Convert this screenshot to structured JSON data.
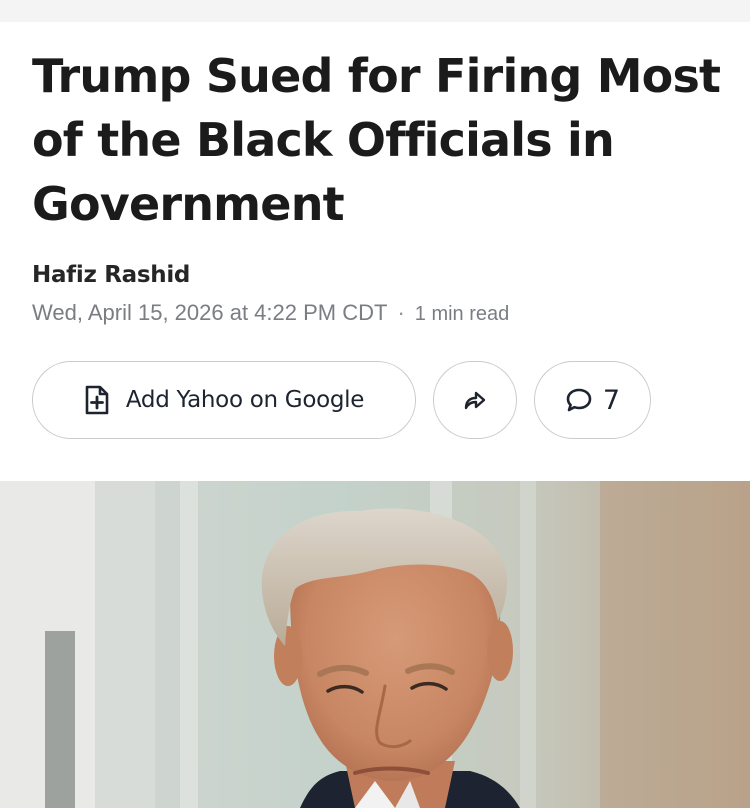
{
  "article": {
    "headline": "Trump Sued for Firing Most of the Black Officials in Government",
    "author": "Hafiz Rashid",
    "published": "Wed, April 15, 2026 at 4:22 PM CDT",
    "separator": "·",
    "read_time": "1 min read"
  },
  "actions": {
    "add_source_label": "Add Yahoo on Google",
    "add_source_icon": "add-document-icon",
    "share_icon": "share-arrow-icon",
    "comments_icon": "comment-bubble-icon",
    "comments_count": "7"
  },
  "colors": {
    "text": "#1b1b1b",
    "meta": "#7a7d82",
    "button_border": "#c9cbcf",
    "background": "#ffffff"
  }
}
